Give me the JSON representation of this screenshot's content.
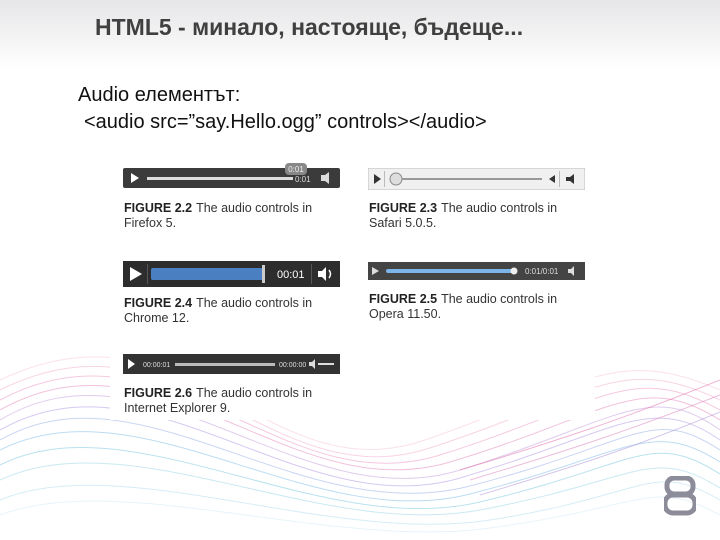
{
  "slide": {
    "title": "HTML5 - минало, настояще, бъдеще...",
    "line1": "Audio елементът:",
    "line2": "<audio src=”say.Hello.ogg” controls></audio>",
    "page_number": "8"
  },
  "figures": [
    {
      "label": "FIGURE 2.2",
      "text1": "The audio controls in",
      "text2": "Firefox 5.",
      "time": "0:01",
      "tooltip": "0:01"
    },
    {
      "label": "FIGURE 2.3",
      "text1": "The audio controls in",
      "text2": "Safari 5.0.5."
    },
    {
      "label": "FIGURE 2.4",
      "text1": "The audio controls in",
      "text2": "Chrome 12.",
      "time": "00:01"
    },
    {
      "label": "FIGURE 2.5",
      "text1": "The audio controls in",
      "text2": "Opera 11.50.",
      "time": "0:01/0:01"
    },
    {
      "label": "FIGURE 2.6",
      "text1": "The audio controls in",
      "text2": "Internet Explorer 9.",
      "time_left": "00:00:01",
      "time_right": "00:00:00"
    }
  ],
  "colors": {
    "title": "#404040",
    "wave_pink": "#e36aa8",
    "wave_blue": "#6a9fd8",
    "logo": "#8c8c9a"
  }
}
